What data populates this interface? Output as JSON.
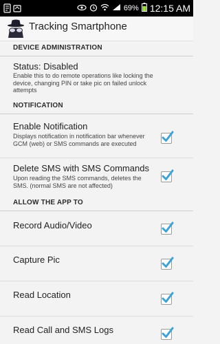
{
  "status_bar": {
    "battery": "69%",
    "time": "12:15 AM"
  },
  "app_bar": {
    "title": "Tracking Smartphone",
    "icon": "spy-icon"
  },
  "sections": {
    "device_admin": {
      "header": "DEVICE ADMINISTRATION",
      "status": {
        "title": "Status: Disabled",
        "summary": "Enable this to do remote operations like locking the device, changing PIN or take pic on failed unlock attempts"
      }
    },
    "notification": {
      "header": "NOTIFICATION",
      "enable_notification": {
        "title": "Enable Notification",
        "summary": "Displays notification in notification bar whenever GCM (web) or SMS commands are executed",
        "checked": true
      },
      "delete_sms": {
        "title": "Delete SMS with SMS Commands",
        "summary": "Upon reading the SMS commands, deletes the SMS. (normal SMS are not affected)",
        "checked": true
      }
    },
    "allow": {
      "header": "ALLOW THE APP TO",
      "record_audio": {
        "title": "Record Audio/Video",
        "checked": true
      },
      "capture_pic": {
        "title": "Capture Pic",
        "checked": true
      },
      "read_location": {
        "title": "Read Location",
        "checked": true
      },
      "read_logs": {
        "title": "Read Call and SMS Logs",
        "checked": true
      }
    }
  },
  "colors": {
    "checkmark": "#3aa3d8",
    "background": "#f3f3f3"
  }
}
